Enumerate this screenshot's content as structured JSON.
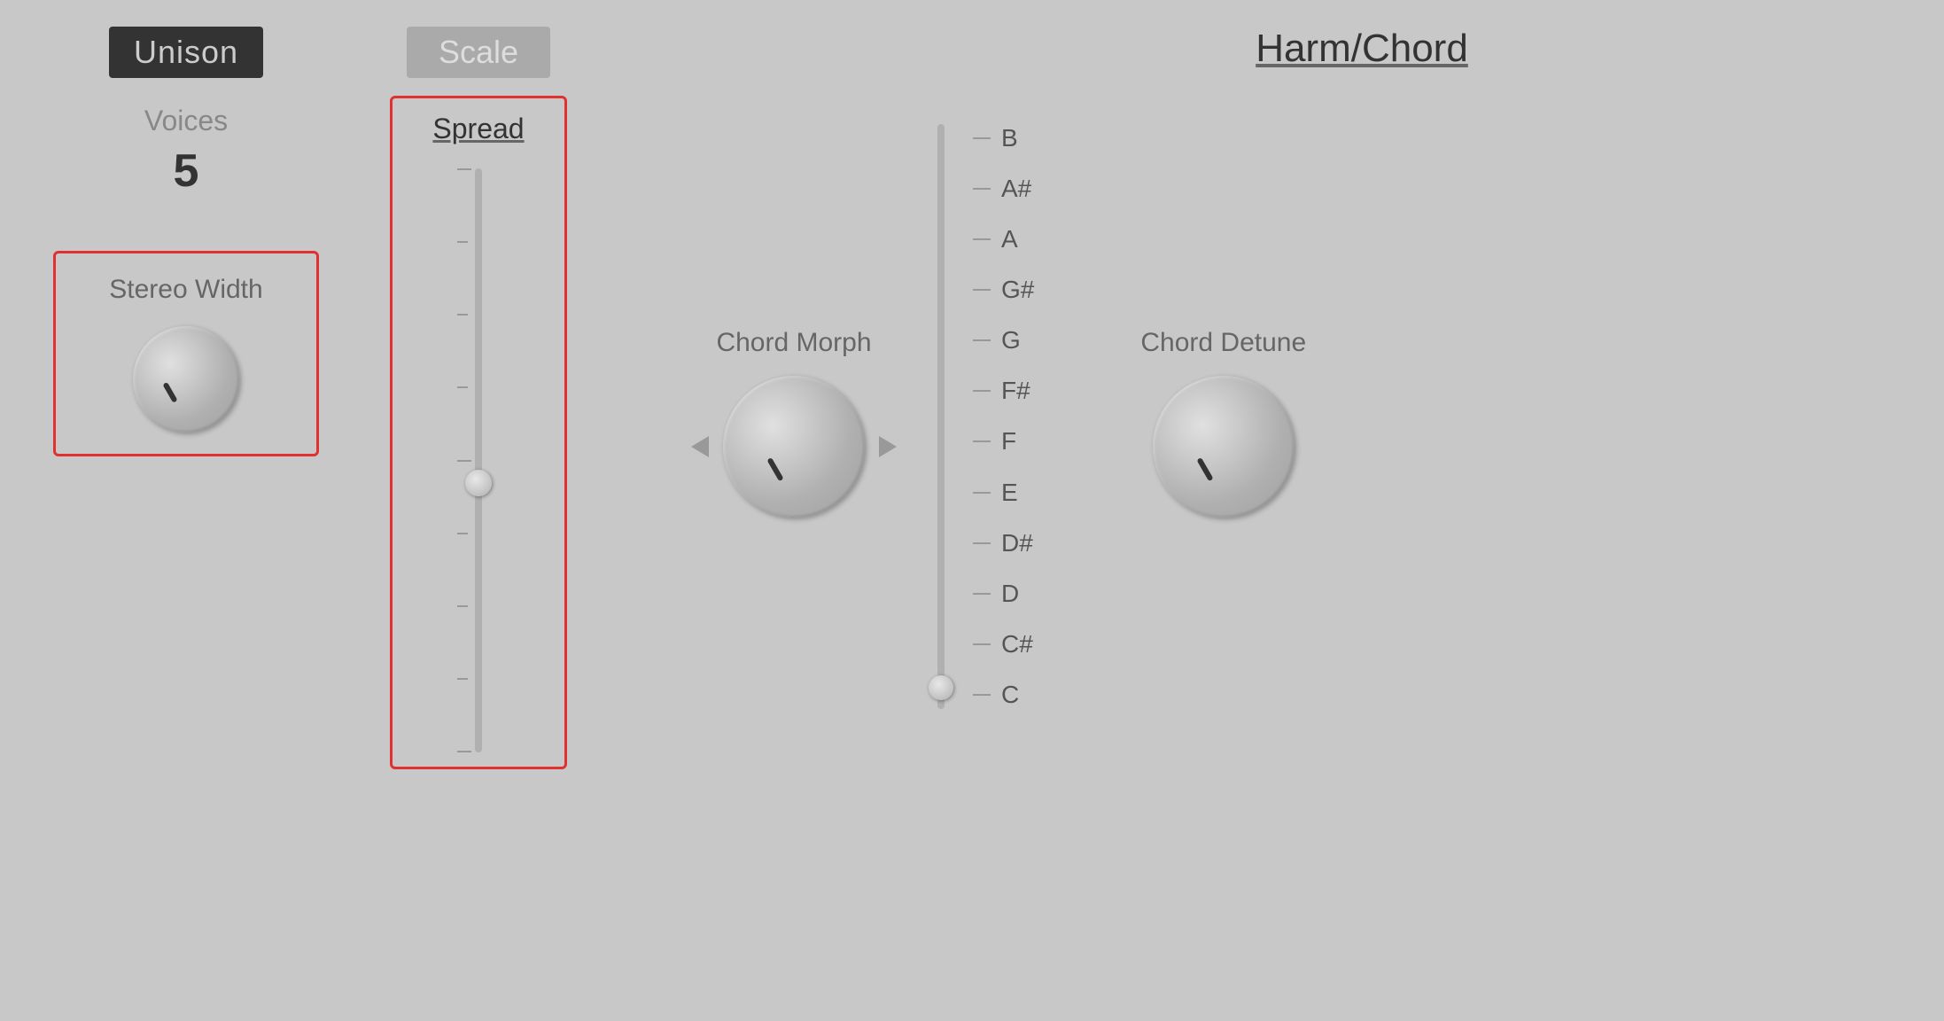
{
  "unison": {
    "badge_label": "Unison",
    "voices_label": "Voices",
    "voices_value": "5",
    "stereo_width_label": "Stereo Width"
  },
  "scale": {
    "badge_label": "Scale",
    "spread_label": "Spread",
    "slider_position_pct": 55
  },
  "harm_chord": {
    "title": "Harm/Chord",
    "chord_morph_label": "Chord Morph",
    "chord_detune_label": "Chord Detune",
    "notes": [
      "B",
      "A#",
      "A",
      "G#",
      "G",
      "F#",
      "F",
      "E",
      "D#",
      "D",
      "C#",
      "C"
    ],
    "note_slider_position_pct": 95
  }
}
